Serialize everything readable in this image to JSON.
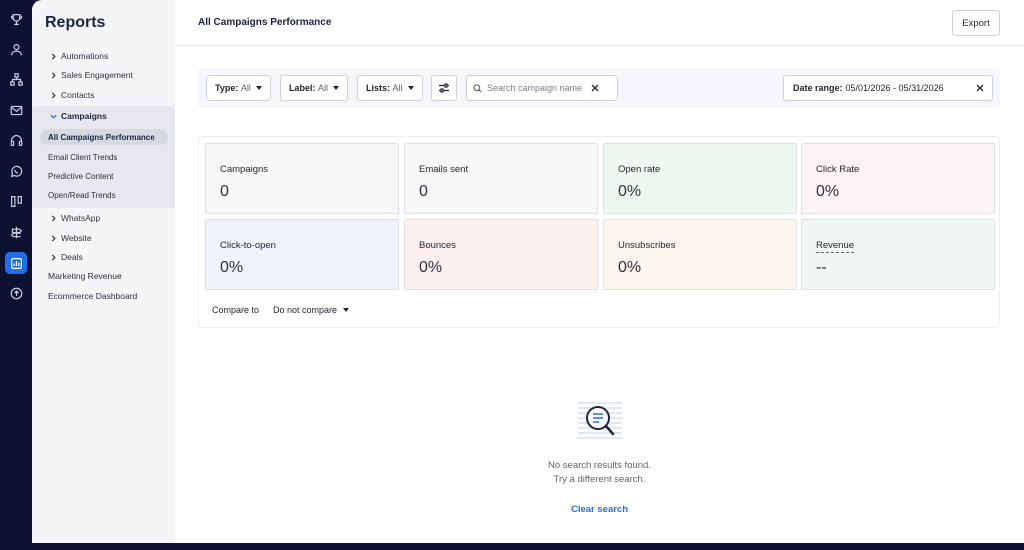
{
  "rail": {
    "icons": [
      "trophy-icon",
      "contacts-icon",
      "sitemap-icon",
      "mail-icon",
      "headset-icon",
      "whatsapp-icon",
      "pipeline-icon",
      "signpost-icon",
      "reports-icon",
      "upload-icon"
    ]
  },
  "sidebar": {
    "title": "Reports",
    "items": [
      {
        "label": "Automations"
      },
      {
        "label": "Sales Engagement"
      },
      {
        "label": "Contacts"
      },
      {
        "label": "Campaigns"
      }
    ],
    "campaign_subitems": [
      {
        "label": "All Campaigns Performance"
      },
      {
        "label": "Email Client Trends"
      },
      {
        "label": "Predictive Content"
      },
      {
        "label": "Open/Read Trends"
      }
    ],
    "more_items": [
      {
        "label": "WhatsApp"
      },
      {
        "label": "Website"
      },
      {
        "label": "Deals"
      }
    ],
    "plain_items": [
      {
        "label": "Marketing Revenue"
      },
      {
        "label": "Ecommerce Dashboard"
      }
    ]
  },
  "header": {
    "title": "All Campaigns Performance",
    "export_label": "Export"
  },
  "filters": {
    "type_key": "Type:",
    "type_value": "All",
    "label_key": "Label:",
    "label_value": "All",
    "lists_key": "Lists:",
    "lists_value": "All",
    "search_placeholder": "Search campaign name",
    "date_key": "Date range:",
    "date_value": "05/01/2026 - 05/31/2026"
  },
  "metrics": [
    {
      "label": "Campaigns",
      "value": "0",
      "bg": "#f7f7f8"
    },
    {
      "label": "Emails sent",
      "value": "0",
      "bg": "#f7f7f8"
    },
    {
      "label": "Open rate",
      "value": "0%",
      "bg": "#eef6f0"
    },
    {
      "label": "Click Rate",
      "value": "0%",
      "bg": "#fdf2f6"
    },
    {
      "label": "Click-to-open",
      "value": "0%",
      "bg": "#f1f3fb"
    },
    {
      "label": "Bounces",
      "value": "0%",
      "bg": "#fdf1f0"
    },
    {
      "label": "Unsubscribes",
      "value": "0%",
      "bg": "#fdf6ef"
    },
    {
      "label": "Revenue",
      "value": "--",
      "bg": "#f1f7f2"
    }
  ],
  "compare": {
    "label": "Compare to",
    "value": "Do not compare"
  },
  "empty_state": {
    "line1": "No search results found.",
    "line2": "Try a different search.",
    "clear_label": "Clear search"
  },
  "colors": {
    "accent": "#1f6feb",
    "rail_bg": "#0d1233"
  }
}
